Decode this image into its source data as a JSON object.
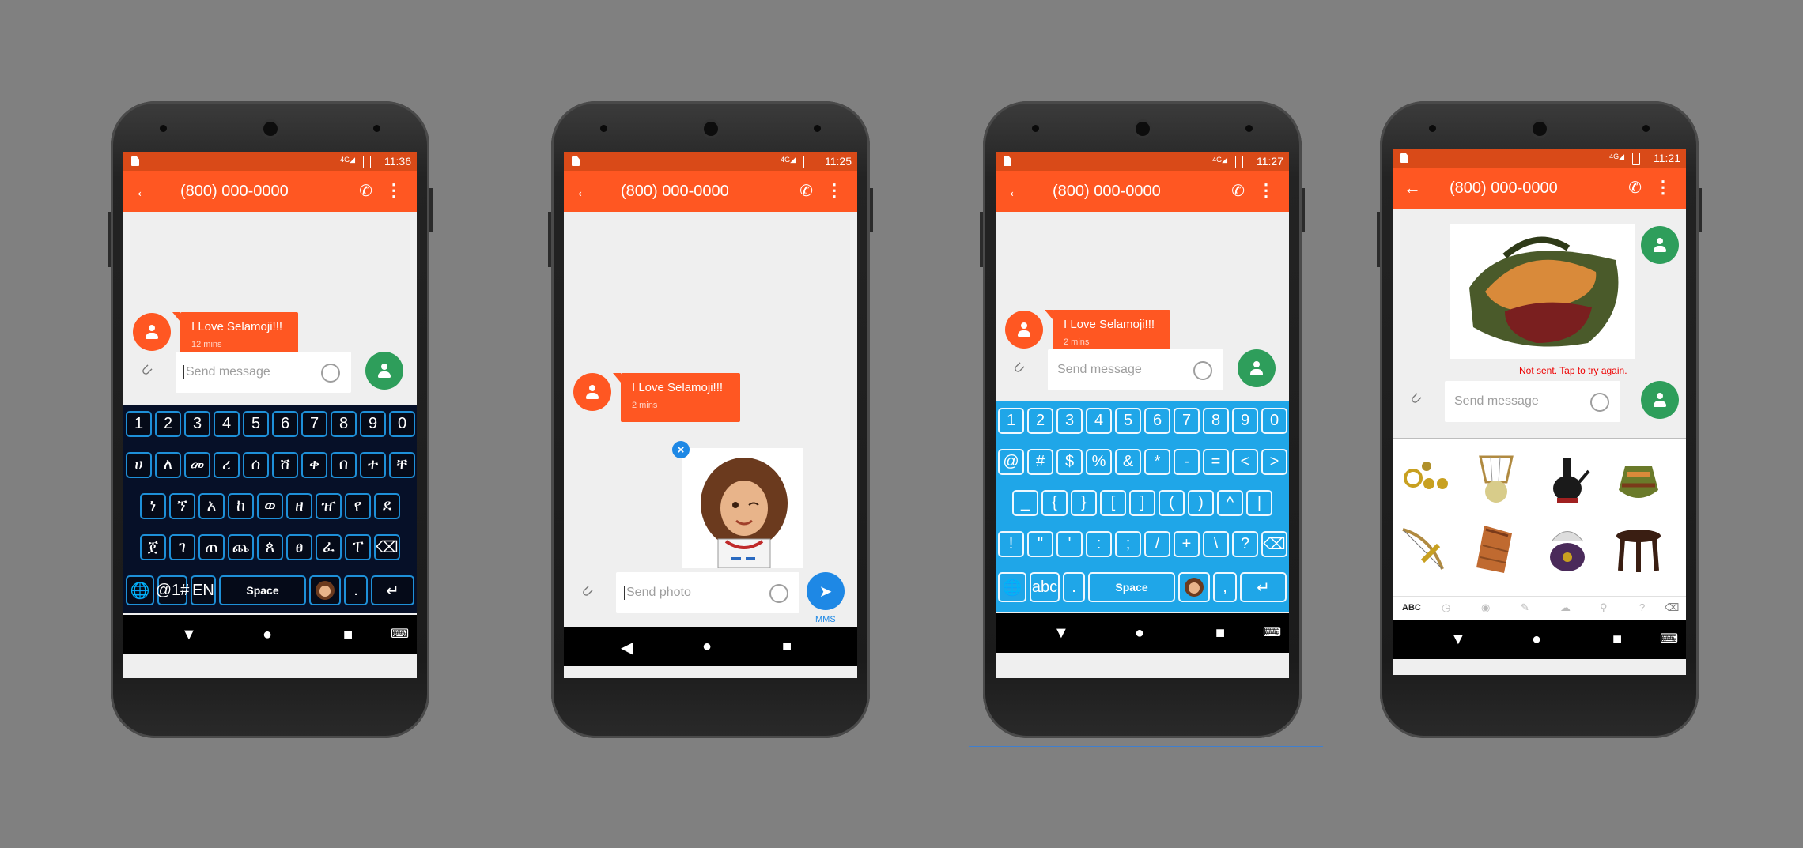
{
  "phones": [
    {
      "status_time": "11:36",
      "contact": "(800) 000-0000",
      "message": {
        "text": "I Love Selamoji!!!",
        "age": "12 mins"
      },
      "composer_placeholder": "Send message",
      "keyboard": {
        "theme": "dark-neon",
        "row1": [
          "1",
          "2",
          "3",
          "4",
          "5",
          "6",
          "7",
          "8",
          "9",
          "0"
        ],
        "row2": [
          "ሀ",
          "ለ",
          "መ",
          "ረ",
          "ሰ",
          "ሸ",
          "ቀ",
          "በ",
          "ተ",
          "ቸ"
        ],
        "row3": [
          "ነ",
          "ኘ",
          "አ",
          "ከ",
          "ወ",
          "ዘ",
          "ዠ",
          "የ",
          "ደ"
        ],
        "row4": [
          "ጀ",
          "ገ",
          "ጠ",
          "ጨ",
          "ጰ",
          "ፀ",
          "ፈ",
          "ፐ",
          "⌫"
        ],
        "bottom": {
          "symbols": "@1#",
          "lang": "EN",
          "space": "Space",
          "dot": "."
        }
      }
    },
    {
      "status_time": "11:25",
      "contact": "(800) 000-0000",
      "message": {
        "text": "I Love Selamoji!!!",
        "age": "2 mins"
      },
      "composer_placeholder": "Send photo",
      "send_label": "MMS"
    },
    {
      "status_time": "11:27",
      "contact": "(800) 000-0000",
      "message": {
        "text": "I Love Selamoji!!!",
        "age": "2 mins"
      },
      "composer_placeholder": "Send message",
      "keyboard": {
        "theme": "blue",
        "row1": [
          "1",
          "2",
          "3",
          "4",
          "5",
          "6",
          "7",
          "8",
          "9",
          "0"
        ],
        "row2": [
          "@",
          "#",
          "$",
          "%",
          "&",
          "*",
          "-",
          "=",
          "<",
          ">"
        ],
        "row3": [
          "_",
          "{",
          "}",
          "[",
          "]",
          "(",
          ")",
          "^",
          "|"
        ],
        "row4": [
          "!",
          "\"",
          "'",
          ":",
          ";",
          "/",
          "+",
          "\\",
          "?",
          "⌫"
        ],
        "bottom": {
          "symbols": "abc",
          "space": "Space",
          "dot": ".",
          "comma": ","
        }
      }
    },
    {
      "status_time": "11:21",
      "contact": "(800) 000-0000",
      "error": "Not sent. Tap to try again.",
      "composer_placeholder": "Send message",
      "sticker_tab": "ABC"
    }
  ],
  "colors": {
    "accent": "#ff5722",
    "statusbar": "#d94a18",
    "contact": "#2e9e5b",
    "kb_blue": "#1fa6e8",
    "kb_dark": "#061028"
  },
  "icons": [
    "back-arrow-icon",
    "phone-icon",
    "more-vert-icon",
    "person-icon",
    "paperclip-icon",
    "emoji-icon",
    "send-icon",
    "globe-icon",
    "enter-icon",
    "backspace-icon"
  ]
}
